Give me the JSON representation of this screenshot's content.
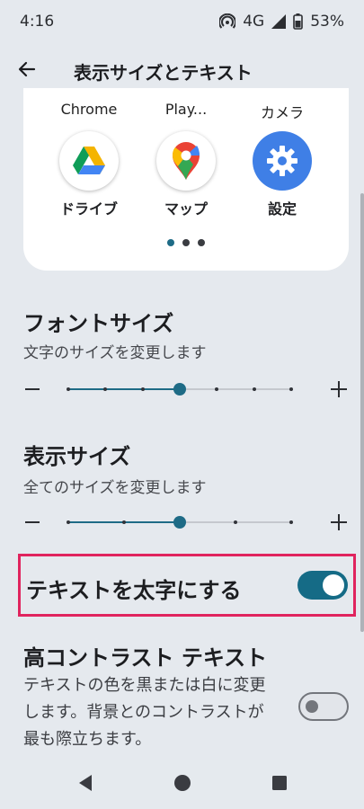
{
  "status_bar": {
    "time": "4:16",
    "network": "4G",
    "battery": "53%",
    "icons": [
      "hotspot-icon",
      "cell-signal-icon",
      "battery-icon"
    ]
  },
  "app_bar": {
    "title": "表示サイズとテキスト",
    "back_icon": "back-arrow-icon"
  },
  "preview": {
    "top_labels": [
      "Chrome",
      "Play...",
      "カメラ"
    ],
    "apps": [
      {
        "name": "ドライブ",
        "icon": "google-drive-icon"
      },
      {
        "name": "マップ",
        "icon": "google-maps-icon"
      },
      {
        "name": "設定",
        "icon": "settings-gear-icon"
      }
    ],
    "page_count": 3,
    "active_page": 0
  },
  "font_size": {
    "title": "フォントサイズ",
    "subtitle": "文字のサイズを変更します",
    "steps": 7,
    "value_index": 3
  },
  "display_size": {
    "title": "表示サイズ",
    "subtitle": "全てのサイズを変更します",
    "steps": 5,
    "value_index": 2
  },
  "bold_text": {
    "label": "テキストを太字にする",
    "enabled": true
  },
  "high_contrast": {
    "title": "高コントラスト テキスト",
    "description": "テキストの色を黒または白に変更します。背景とのコントラストが最も際立ちます。",
    "enabled": false
  },
  "nav_bar": {
    "buttons": [
      "back-triangle-icon",
      "home-circle-icon",
      "recents-square-icon"
    ]
  },
  "colors": {
    "accent": "#1e6b86",
    "highlight_border": "#e0245e",
    "background": "#e5e9ee"
  }
}
